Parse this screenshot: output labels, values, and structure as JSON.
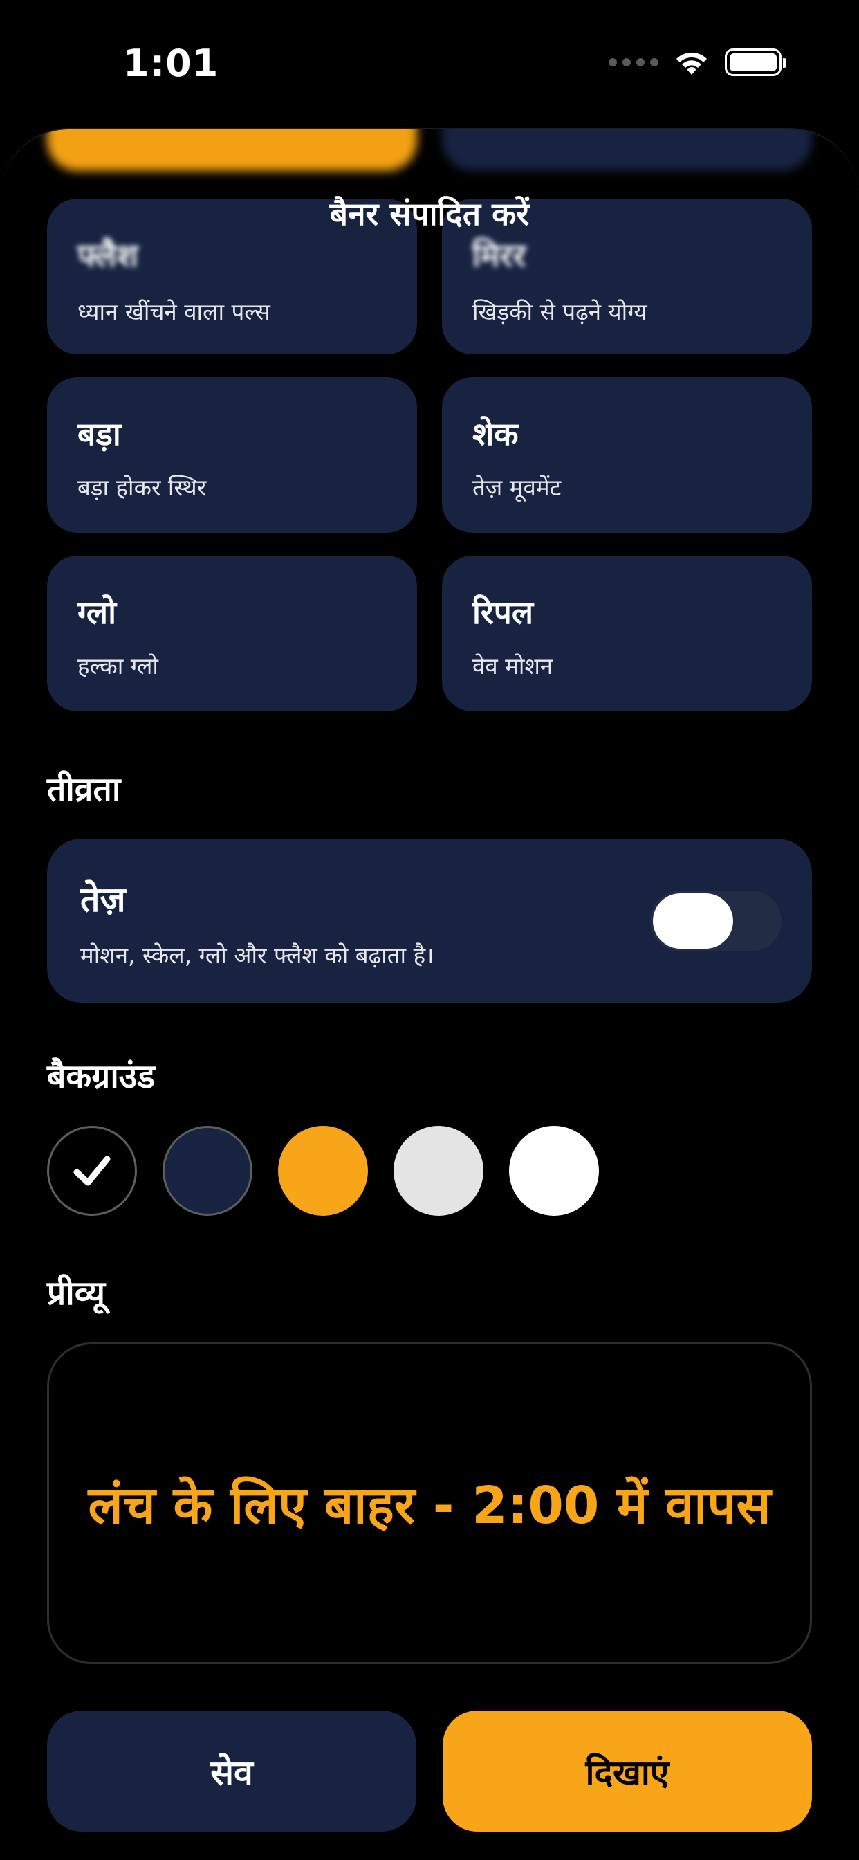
{
  "status_bar": {
    "time": "1:01"
  },
  "sheet": {
    "title": "बैनर संपादित करें"
  },
  "effects": {
    "peek": [
      "",
      ""
    ],
    "items": [
      {
        "title": "फ्लैश",
        "subtitle": "ध्यान खींचने वाला पल्स"
      },
      {
        "title": "मिरर",
        "subtitle": "खिड़की से पढ़ने योग्य"
      },
      {
        "title": "बड़ा",
        "subtitle": "बड़ा होकर स्थिर"
      },
      {
        "title": "शेक",
        "subtitle": "तेज़ मूवमेंट"
      },
      {
        "title": "ग्लो",
        "subtitle": "हल्का ग्लो"
      },
      {
        "title": "रिपल",
        "subtitle": "वेव मोशन"
      }
    ]
  },
  "intensity": {
    "label": "तीव्रता",
    "option_title": "तेज़",
    "option_desc": "मोशन, स्केल, ग्लो और फ्लैश को बढ़ाता है।",
    "toggle_on": false
  },
  "background": {
    "label": "बैकग्राउंड",
    "colors": [
      "#000000",
      "#172341",
      "#F9A51A",
      "#E4E4E4",
      "#FFFFFF"
    ],
    "selected_index": 0
  },
  "preview": {
    "label": "प्रीव्यू",
    "text": "लंच के लिए बाहर - 2:00 में वापस",
    "text_color": "#F9A51A"
  },
  "actions": {
    "save_label": "सेव",
    "show_label": "दिखाएं"
  },
  "colors": {
    "accent": "#F9A51A",
    "card": "#172341"
  }
}
